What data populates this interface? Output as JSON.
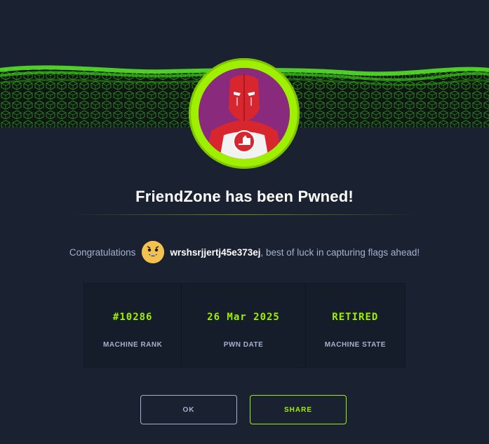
{
  "dialog": {
    "title": "FriendZone has been Pwned!",
    "congrats_prefix": "Congratulations",
    "username": "wrshsrjjertj45e373ej",
    "congrats_suffix": ", best of luck in capturing flags ahead!"
  },
  "stats": [
    {
      "value": "#10286",
      "label": "MACHINE RANK"
    },
    {
      "value": "26 Mar 2025",
      "label": "PWN DATE"
    },
    {
      "value": "RETIRED",
      "label": "MACHINE STATE"
    }
  ],
  "buttons": {
    "ok_label": "OK",
    "share_label": "SHARE"
  },
  "colors": {
    "background": "#1a2232",
    "accent": "#9fef00",
    "muted_text": "#a4b1cd",
    "avatar_bg": "#8a2a7c",
    "mascot_red": "#d7262e"
  },
  "icons": {
    "banner": "green-cube-wave-banner",
    "machine_avatar": "red-masked-hero-machine-avatar",
    "user_avatar": "cartoon-face-user-avatar"
  }
}
